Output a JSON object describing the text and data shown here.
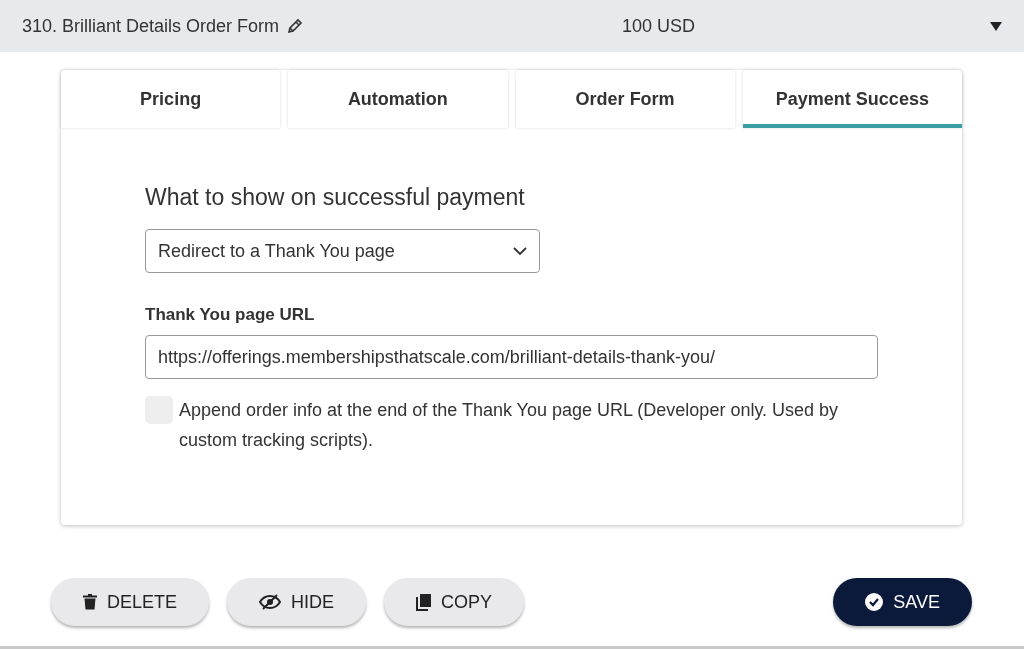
{
  "header": {
    "title": "310. Brilliant Details Order Form",
    "price": "100 USD",
    "expanded": true
  },
  "tabs": [
    {
      "label": "Pricing",
      "selected": false
    },
    {
      "label": "Automation",
      "selected": false
    },
    {
      "label": "Order Form",
      "selected": false
    },
    {
      "label": "Payment Success",
      "selected": true
    }
  ],
  "section_title": "What to show on successful payment",
  "dropdown": {
    "value": "Redirect to a Thank You page"
  },
  "url_field": {
    "label": "Thank You page URL",
    "value": "https://offerings.membershipsthatscale.com/brilliant-details-thank-you/"
  },
  "append_option": {
    "label": "Append order info at the end of the Thank You page URL (Developer only. Used by custom tracking scripts).",
    "checked": false
  },
  "buttons": [
    {
      "kind": "delete",
      "label": "DELETE"
    },
    {
      "kind": "hide",
      "label": "HIDE"
    },
    {
      "kind": "copy",
      "label": "COPY"
    },
    {
      "kind": "save",
      "label": "SAVE"
    }
  ]
}
